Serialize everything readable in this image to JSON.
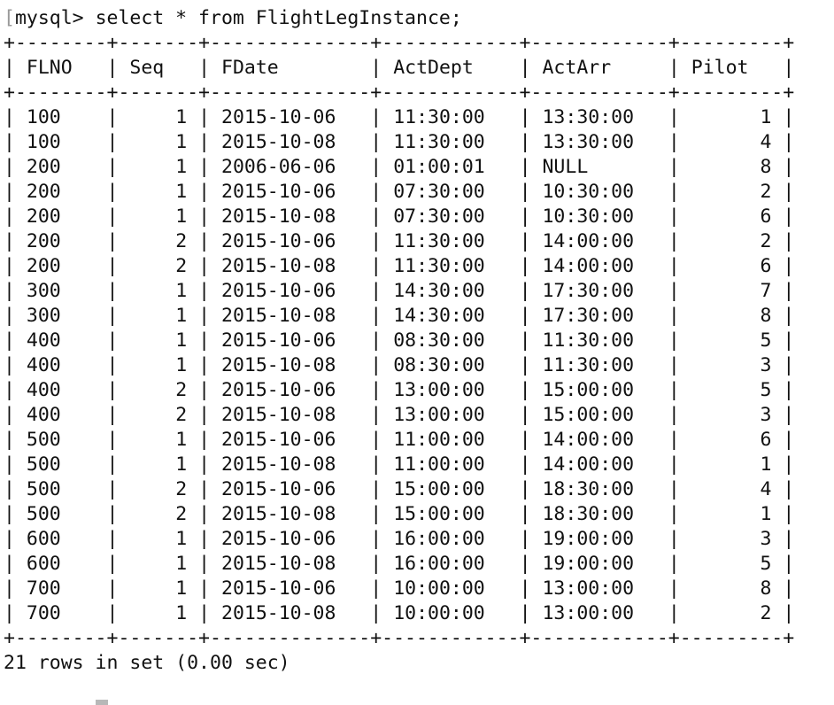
{
  "terminal": {
    "prompt": "mysql> ",
    "command": "select * from FlightLegInstance;",
    "table": {
      "columns": [
        {
          "name": "FLNO",
          "width": 6,
          "align": "left"
        },
        {
          "name": "Seq",
          "width": 5,
          "align": "right"
        },
        {
          "name": "FDate",
          "width": 12,
          "align": "left"
        },
        {
          "name": "ActDept",
          "width": 10,
          "align": "left"
        },
        {
          "name": "ActArr",
          "width": 10,
          "align": "left"
        },
        {
          "name": "Pilot",
          "width": 7,
          "align": "right"
        }
      ],
      "rows": [
        [
          "100",
          "1",
          "2015-10-06",
          "11:30:00",
          "13:30:00",
          "1"
        ],
        [
          "100",
          "1",
          "2015-10-08",
          "11:30:00",
          "13:30:00",
          "4"
        ],
        [
          "200",
          "1",
          "2006-06-06",
          "01:00:01",
          "NULL",
          "8"
        ],
        [
          "200",
          "1",
          "2015-10-06",
          "07:30:00",
          "10:30:00",
          "2"
        ],
        [
          "200",
          "1",
          "2015-10-08",
          "07:30:00",
          "10:30:00",
          "6"
        ],
        [
          "200",
          "2",
          "2015-10-06",
          "11:30:00",
          "14:00:00",
          "2"
        ],
        [
          "200",
          "2",
          "2015-10-08",
          "11:30:00",
          "14:00:00",
          "6"
        ],
        [
          "300",
          "1",
          "2015-10-06",
          "14:30:00",
          "17:30:00",
          "7"
        ],
        [
          "300",
          "1",
          "2015-10-08",
          "14:30:00",
          "17:30:00",
          "8"
        ],
        [
          "400",
          "1",
          "2015-10-06",
          "08:30:00",
          "11:30:00",
          "5"
        ],
        [
          "400",
          "1",
          "2015-10-08",
          "08:30:00",
          "11:30:00",
          "3"
        ],
        [
          "400",
          "2",
          "2015-10-06",
          "13:00:00",
          "15:00:00",
          "5"
        ],
        [
          "400",
          "2",
          "2015-10-08",
          "13:00:00",
          "15:00:00",
          "3"
        ],
        [
          "500",
          "1",
          "2015-10-06",
          "11:00:00",
          "14:00:00",
          "6"
        ],
        [
          "500",
          "1",
          "2015-10-08",
          "11:00:00",
          "14:00:00",
          "1"
        ],
        [
          "500",
          "2",
          "2015-10-06",
          "15:00:00",
          "18:30:00",
          "4"
        ],
        [
          "500",
          "2",
          "2015-10-08",
          "15:00:00",
          "18:30:00",
          "1"
        ],
        [
          "600",
          "1",
          "2015-10-06",
          "16:00:00",
          "19:00:00",
          "3"
        ],
        [
          "600",
          "1",
          "2015-10-08",
          "16:00:00",
          "19:00:00",
          "5"
        ],
        [
          "700",
          "1",
          "2015-10-06",
          "10:00:00",
          "13:00:00",
          "8"
        ],
        [
          "700",
          "1",
          "2015-10-08",
          "10:00:00",
          "13:00:00",
          "2"
        ]
      ]
    },
    "summary": "21 rows in set (0.00 sec)"
  }
}
